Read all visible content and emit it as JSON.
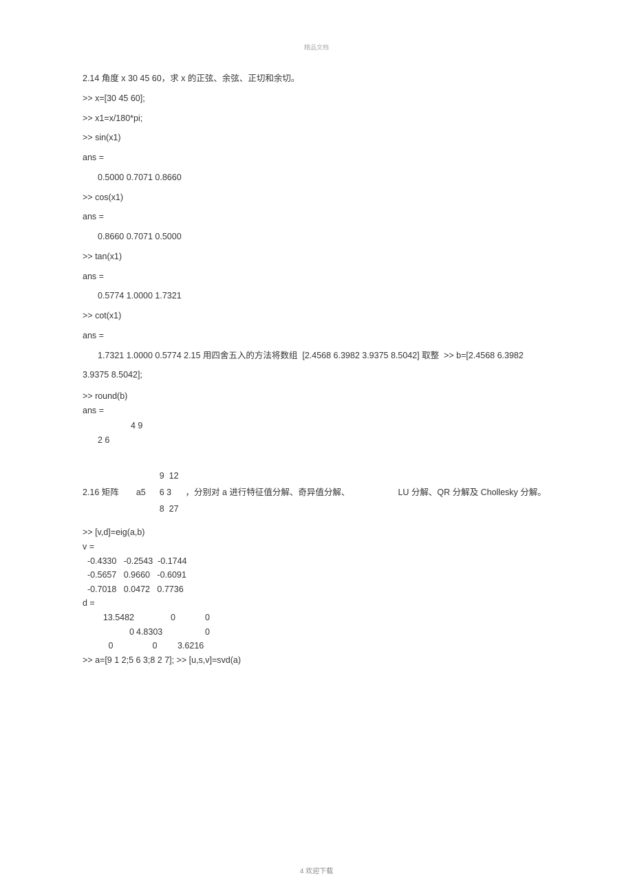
{
  "header": "精品文档",
  "footer": "4 欢迎下载",
  "lines": {
    "l1": "2.14 角度 x 30 45 60，求 x 的正弦、余弦、正切和余切。",
    "l2": ">> x=[30 45 60];",
    "l3": ">> x1=x/180*pi;",
    "l4": ">> sin(x1)",
    "l5": "ans =",
    "l6": "0.5000 0.7071 0.8660",
    "l7": ">> cos(x1)",
    "l8": "ans =",
    "l9": "0.8660 0.7071 0.5000",
    "l10": ">> tan(x1)",
    "l11": "ans =",
    "l12": "0.5774 1.0000 1.7321",
    "l13": ">> cot(x1)",
    "l14": "ans =",
    "l15": "1.7321 1.0000 0.5774 2.15 用四舍五入的方法将数组  [2.4568 6.3982 3.9375 8.5042] 取整  >> b=[2.4568 6.3982",
    "l16": "3.9375 8.5042];",
    "l17": ">> round(b)",
    "l18": "ans =",
    "l19_a": "4 9",
    "l19_b": "2 6",
    "s216_label": "2.16 矩阵",
    "s216_a5": "a5",
    "matrix_r1": "9  12",
    "matrix_r2": "6 3",
    "matrix_r3": "8  27",
    "s216_text1": "，分别对 a 进行特征值分解、奇异值分解、",
    "s216_text2": "LU 分解、QR 分解及 Chollesky 分解。",
    "e1": ">> [v,d]=eig(a,b)",
    "e2": "v =",
    "e3": "  -0.4330   -0.2543  -0.1744",
    "e4": "  -0.5657   0.9660   -0.6091",
    "e5": "  -0.7018   0.0472   0.7736",
    "e6": "d =",
    "d_r1c1": "13.5482",
    "d_r1c2": "0",
    "d_r1c3": "0",
    "d_r2c1": "0",
    "d_r2c2": "4.8303",
    "d_r2c3": "0",
    "d_r3c1": "0",
    "d_r3c2": "0",
    "d_r3c3": "3.6216",
    "e10": ">> a=[9 1 2;5 6 3;8 2 7]; >> [u,s,v]=svd(a)"
  }
}
